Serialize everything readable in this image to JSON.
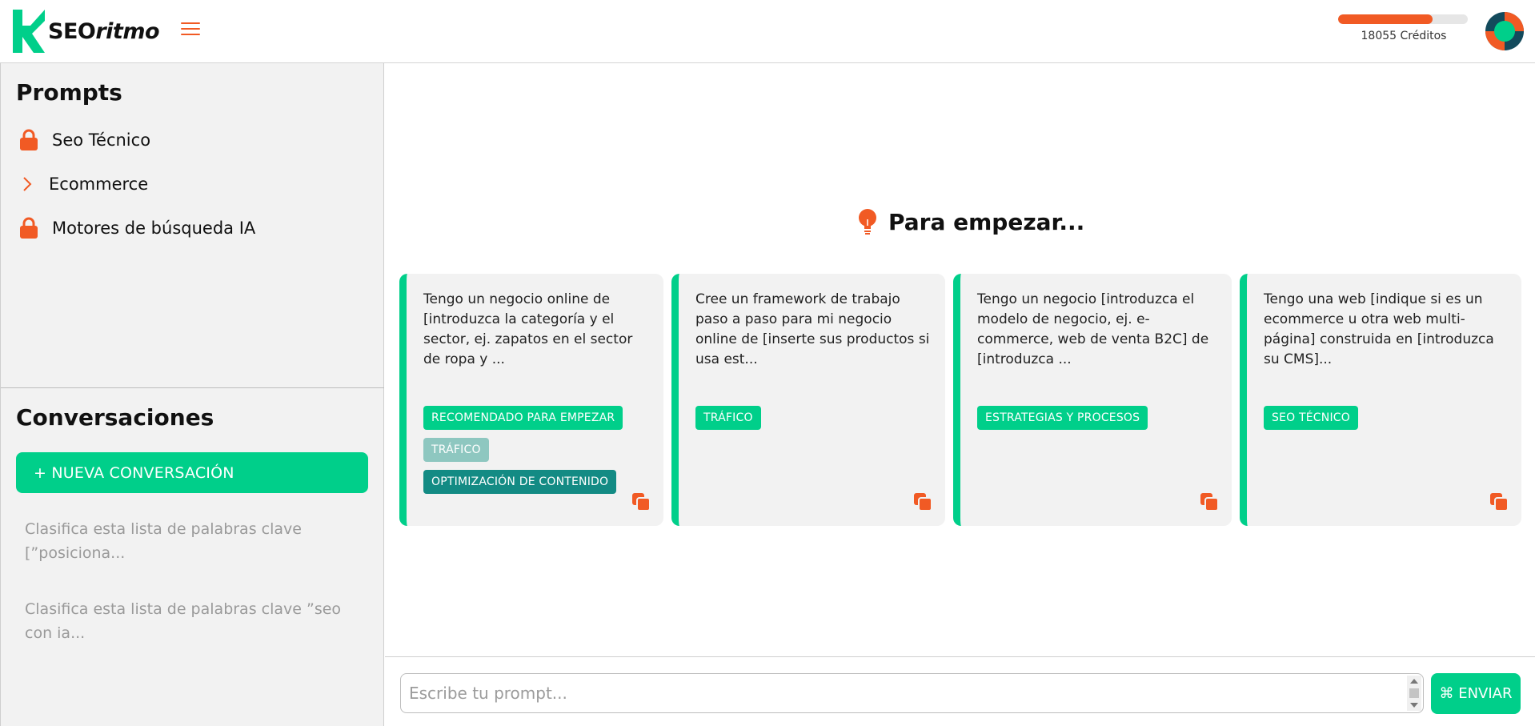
{
  "header": {
    "logo_text_bold": "SEO",
    "logo_text_rest": "ritmo",
    "credits_label": "18055 Créditos",
    "credits_fraction": 0.73
  },
  "colors": {
    "accent": "#f15a24",
    "primary": "#00cf8a",
    "teal": "#138b84",
    "teal_light": "#8ec7c0"
  },
  "sidebar": {
    "prompts_title": "Prompts",
    "prompts": [
      {
        "label": "Seo Técnico",
        "icon": "lock-icon"
      },
      {
        "label": "Ecommerce",
        "icon": "chevron-right-icon"
      },
      {
        "label": "Motores de búsqueda IA",
        "icon": "lock-icon"
      }
    ],
    "conversations_title": "Conversaciones",
    "new_conversation_label": "+ NUEVA CONVERSACIÓN",
    "conversations": [
      "Clasifica esta lista de palabras clave [”posiciona...",
      "Clasifica esta lista de palabras clave ”seo con ia..."
    ]
  },
  "main": {
    "heading": "Para empezar...",
    "cards": [
      {
        "text": "Tengo un negocio online de [introduzca la categoría y el sector, ej. zapatos en el sector de ropa y ...",
        "tags": [
          "RECOMENDADO PARA EMPEZAR",
          "TRÁFICO",
          "OPTIMIZACIÓN DE CONTENIDO"
        ]
      },
      {
        "text": "Cree un framework de trabajo paso a paso para mi negocio online de [inserte sus productos si usa est...",
        "tags": [
          "TRÁFICO"
        ]
      },
      {
        "text": "Tengo un negocio [introduzca el modelo de negocio, ej. e-commerce, web de venta B2C] de [introduzca ...",
        "tags": [
          "ESTRATEGIAS Y PROCESOS"
        ]
      },
      {
        "text": "Tengo una web [indique si es un ecommerce u otra web multi-página] construida en [introduzca su CMS]...",
        "tags": [
          "SEO TÉCNICO"
        ]
      }
    ]
  },
  "composer": {
    "placeholder": "Escribe tu prompt...",
    "send_label": "⌘ ENVIAR"
  }
}
